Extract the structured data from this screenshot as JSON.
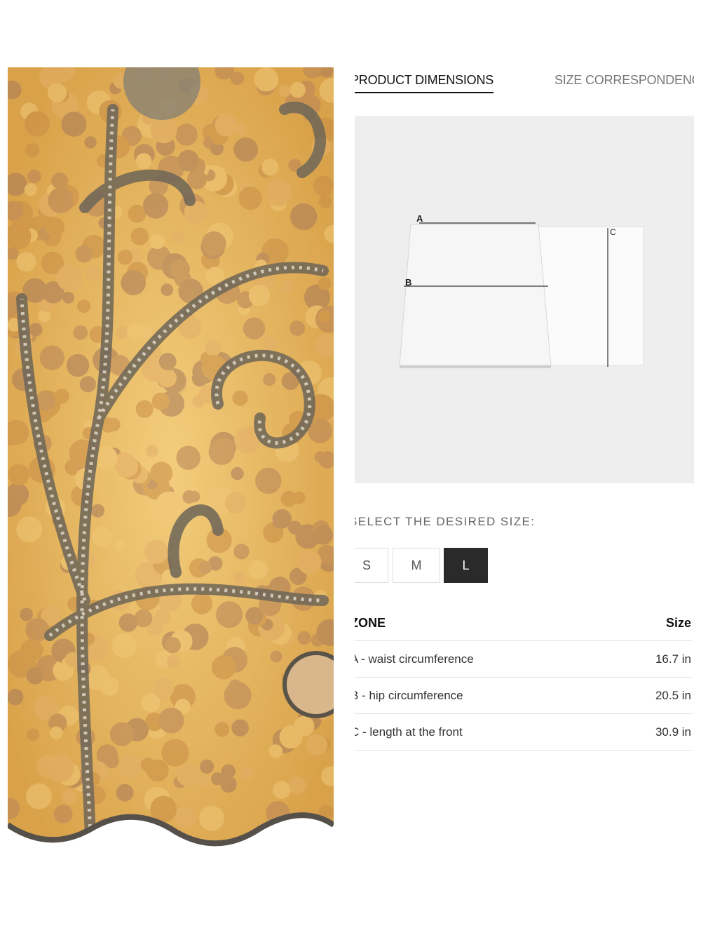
{
  "tabs": {
    "active": "PRODUCT DIMENSIONS",
    "inactive": "SIZE CORRESPONDENCE"
  },
  "diagram": {
    "labels": [
      "A",
      "B",
      "C"
    ]
  },
  "size_selector": {
    "prompt": "SELECT THE DESIRED SIZE:",
    "options": [
      "S",
      "M",
      "L"
    ],
    "selected": "L"
  },
  "dimensions_table": {
    "headers": {
      "zone": "ZONE",
      "size": "Size"
    },
    "rows": [
      {
        "zone": "A - waist circumference",
        "size": "16.7 in"
      },
      {
        "zone": "B - hip circumference",
        "size": "20.5 in"
      },
      {
        "zone": "C - length at the front",
        "size": "30.9 in"
      }
    ]
  },
  "colors": {
    "selected_size_bg": "#2a2a2a",
    "diagram_bg": "#eeeeef",
    "sequin_gold": "#e8b45a"
  }
}
